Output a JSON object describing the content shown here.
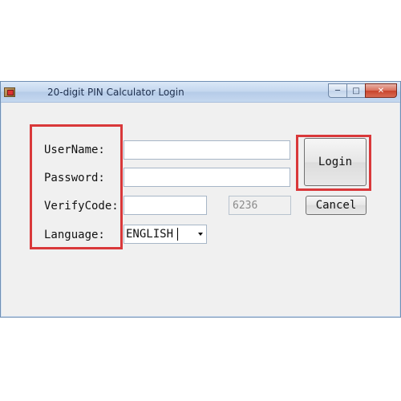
{
  "window": {
    "title": "20-digit PIN Calculator Login",
    "controls": {
      "minimize": "─",
      "maximize": "□",
      "close": "✕"
    }
  },
  "form": {
    "username_label": "UserName:",
    "password_label": "Password:",
    "verifycode_label": "VerifyCode:",
    "language_label": "Language:",
    "username_value": "",
    "password_value": "",
    "verifycode_value": "",
    "verify_display": "6236",
    "language_selected": "ENGLISH"
  },
  "buttons": {
    "login": "Login",
    "cancel": "Cancel"
  },
  "colors": {
    "highlight": "#d9383a",
    "window_bg": "#f0f0f0"
  }
}
